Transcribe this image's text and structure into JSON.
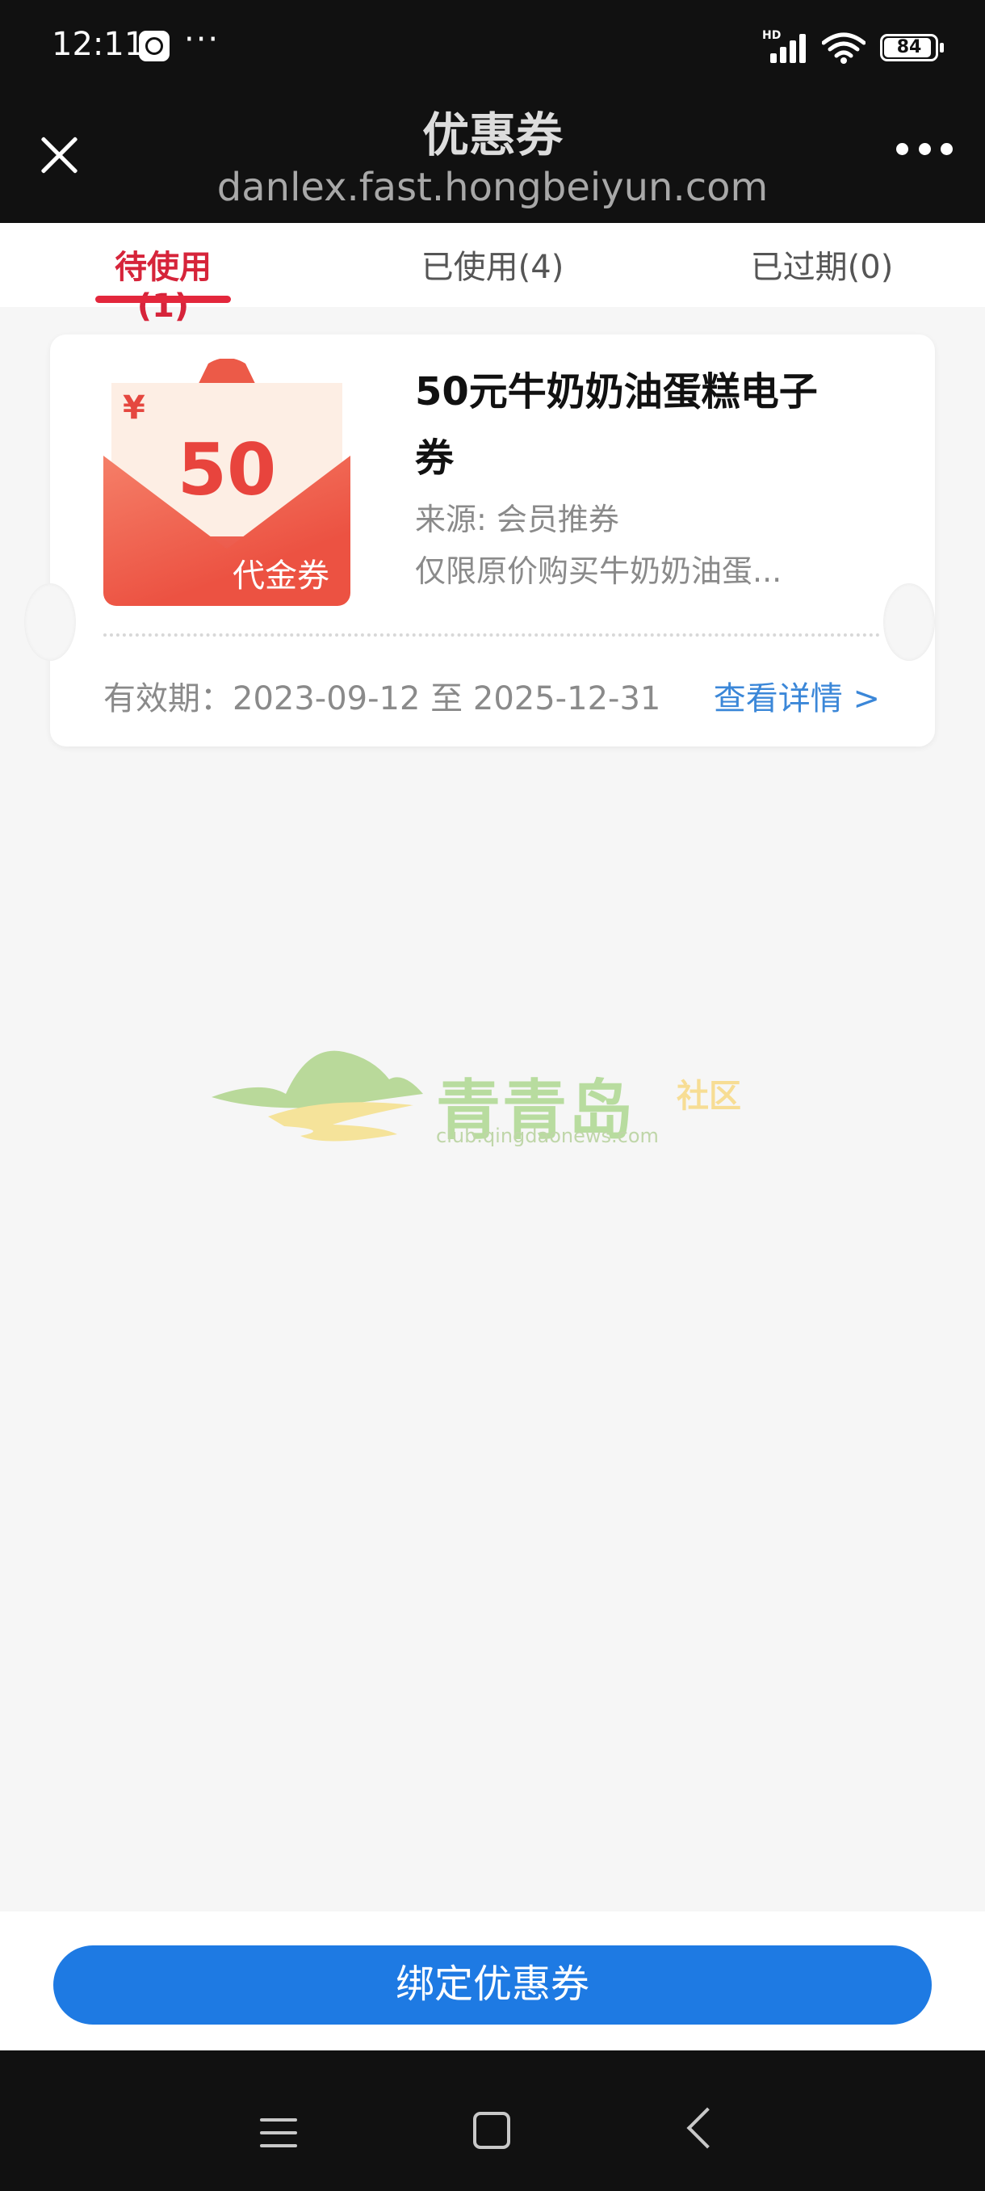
{
  "status_bar": {
    "time": "12:11",
    "dots": "···",
    "network_label": "HD",
    "battery": "84"
  },
  "header": {
    "title": "优惠券",
    "url": "danlex.fast.hongbeiyun.com"
  },
  "tabs": [
    {
      "label": "待使用(1)",
      "active": true
    },
    {
      "label": "已使用(4)",
      "active": false
    },
    {
      "label": "已过期(0)",
      "active": false
    }
  ],
  "coupon": {
    "currency_symbol": "¥",
    "amount": "50",
    "badge_label": "代金券",
    "title": "50元牛奶奶油蛋糕电子券",
    "source": "来源: 会员推券",
    "description": "仅限原价购买牛奶奶油蛋...",
    "validity": "有效期：2023-09-12 至 2025-12-31",
    "details_link": "查看详情 >"
  },
  "watermark": {
    "name": "青青岛",
    "suffix": "社区",
    "url": "club.qingdaonews.com"
  },
  "footer": {
    "bind_button": "绑定优惠券"
  },
  "colors": {
    "accent_red": "#e3273c",
    "button_blue": "#1e7ae3",
    "link_blue": "#3b87d8"
  }
}
